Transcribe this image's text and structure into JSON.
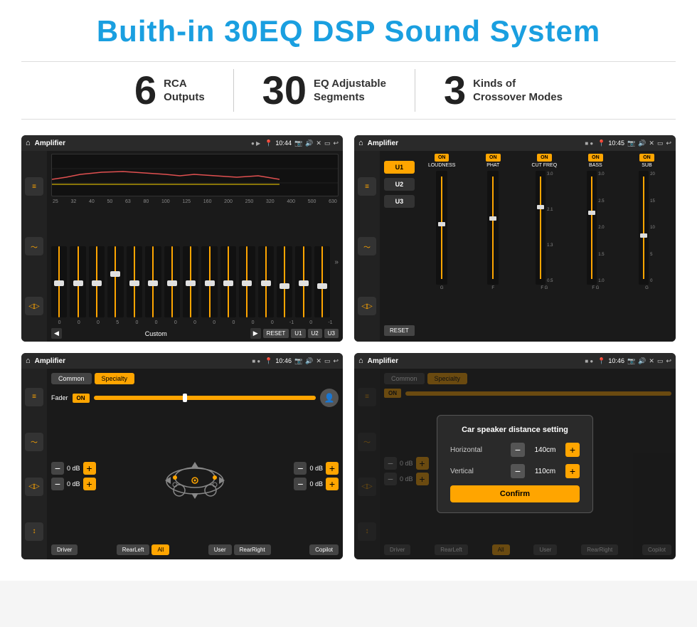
{
  "page": {
    "title": "Buith-in 30EQ DSP Sound System",
    "stats": [
      {
        "number": "6",
        "label": "RCA\nOutputs"
      },
      {
        "number": "30",
        "label": "EQ Adjustable\nSegments"
      },
      {
        "number": "3",
        "label": "Kinds of\nCrossover Modes"
      }
    ]
  },
  "screens": {
    "eq": {
      "title": "Amplifier",
      "time": "10:44",
      "frequencies": [
        "25",
        "32",
        "40",
        "50",
        "63",
        "80",
        "100",
        "125",
        "160",
        "200",
        "250",
        "320",
        "400",
        "500",
        "630"
      ],
      "values": [
        "0",
        "0",
        "0",
        "5",
        "0",
        "0",
        "0",
        "0",
        "0",
        "0",
        "0",
        "0",
        "-1",
        "0",
        "-1"
      ],
      "mode": "Custom",
      "buttons": [
        "RESET",
        "U1",
        "U2",
        "U3"
      ]
    },
    "crossover": {
      "title": "Amplifier",
      "time": "10:45",
      "presets": [
        "U1",
        "U2",
        "U3"
      ],
      "channels": [
        {
          "toggle": "ON",
          "name": "LOUDNESS"
        },
        {
          "toggle": "ON",
          "name": "PHAT"
        },
        {
          "toggle": "ON",
          "name": "CUT FREQ"
        },
        {
          "toggle": "ON",
          "name": "BASS"
        },
        {
          "toggle": "ON",
          "name": "SUB"
        }
      ],
      "reset": "RESET"
    },
    "fader": {
      "title": "Amplifier",
      "time": "10:46",
      "tabs": [
        "Common",
        "Specialty"
      ],
      "faderLabel": "Fader",
      "faderToggle": "ON",
      "levels": [
        {
          "value": "0 dB"
        },
        {
          "value": "0 dB"
        },
        {
          "value": "0 dB"
        },
        {
          "value": "0 dB"
        }
      ],
      "buttons": [
        "Driver",
        "RearLeft",
        "All",
        "User",
        "RearRight",
        "Copilot"
      ]
    },
    "distance": {
      "title": "Amplifier",
      "time": "10:46",
      "tabs": [
        "Common",
        "Specialty"
      ],
      "dialog": {
        "title": "Car speaker distance setting",
        "horizontal_label": "Horizontal",
        "horizontal_value": "140cm",
        "vertical_label": "Vertical",
        "vertical_value": "110cm",
        "confirm": "Confirm"
      },
      "levels": [
        {
          "value": "0 dB"
        },
        {
          "value": "0 dB"
        }
      ],
      "buttons": [
        "Driver",
        "RearLeft",
        "All",
        "User",
        "RearRight",
        "Copilot"
      ]
    }
  }
}
